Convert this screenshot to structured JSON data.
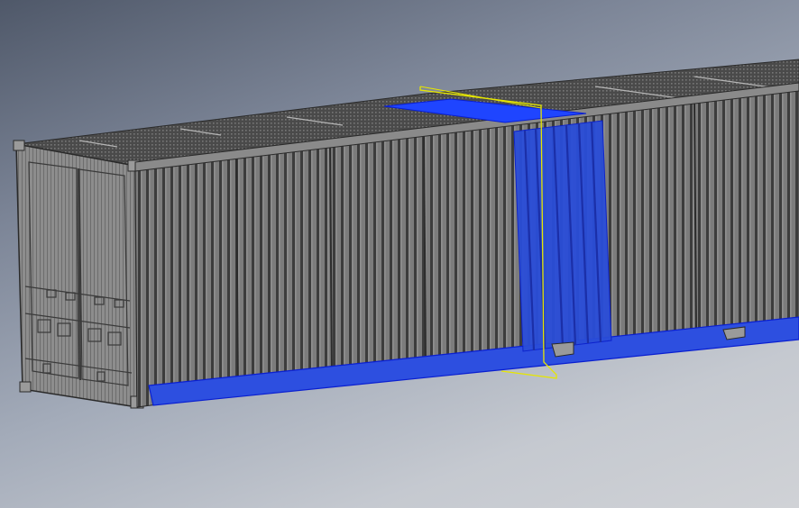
{
  "scene": {
    "background_top": "#4f5869",
    "background_bottom": "#d0d2d6",
    "container_color": "#7a7a7a",
    "rib_color": "#3a3a3a",
    "edge_color": "#222222",
    "highlight_color": "#1133ff",
    "section_plane_color": "#e6e600"
  }
}
